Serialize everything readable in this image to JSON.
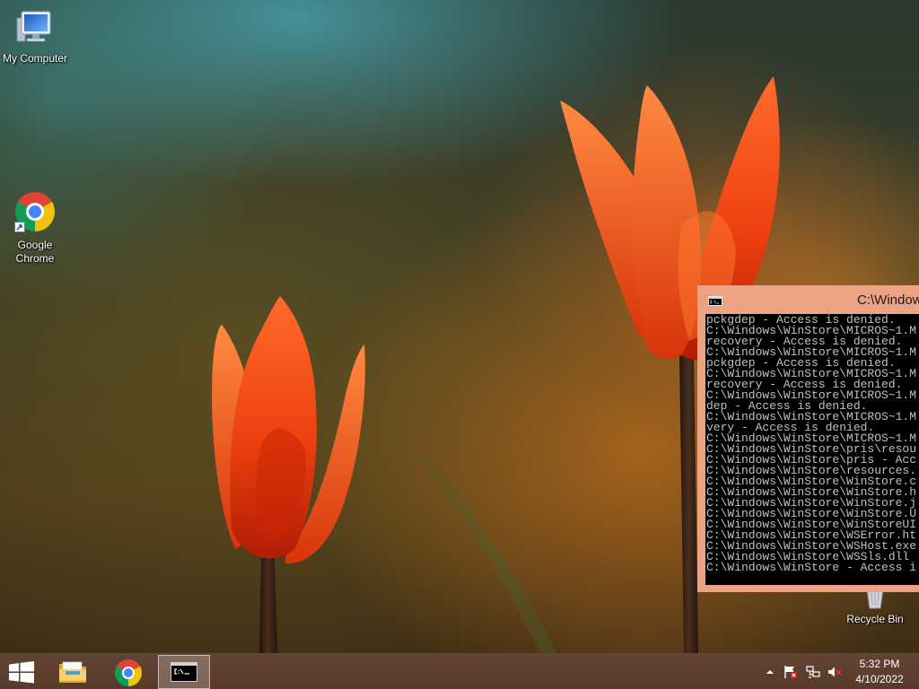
{
  "desktop": {
    "icons": {
      "my_computer": {
        "label": "My Computer",
        "icon": "my-computer-icon"
      },
      "chrome": {
        "label": "Google Chrome",
        "icon": "chrome-icon",
        "overlay": "shortcut-arrow-icon"
      },
      "recycle_bin": {
        "label": "Recycle Bin",
        "icon": "recycle-bin-icon"
      }
    }
  },
  "console_window": {
    "title": "C:\\Window",
    "icon": "cmd-icon",
    "lines": [
      "pckgdep - Access is denied.",
      "C:\\Windows\\WinStore\\MICROS~1.M",
      "recovery - Access is denied.",
      "C:\\Windows\\WinStore\\MICROS~1.M",
      "pckgdep - Access is denied.",
      "C:\\Windows\\WinStore\\MICROS~1.M",
      "recovery - Access is denied.",
      "C:\\Windows\\WinStore\\MICROS~1.M",
      "dep - Access is denied.",
      "C:\\Windows\\WinStore\\MICROS~1.M",
      "very - Access is denied.",
      "C:\\Windows\\WinStore\\MICROS~1.M",
      "C:\\Windows\\WinStore\\pris\\resou",
      "C:\\Windows\\WinStore\\pris - Acc",
      "C:\\Windows\\WinStore\\resources.",
      "C:\\Windows\\WinStore\\WinStore.c",
      "C:\\Windows\\WinStore\\WinStore.h",
      "C:\\Windows\\WinStore\\WinStore.j",
      "C:\\Windows\\WinStore\\WinStore.U",
      "C:\\Windows\\WinStore\\WinStoreUI",
      "C:\\Windows\\WinStore\\WSError.ht",
      "C:\\Windows\\WinStore\\WSHost.exe",
      "C:\\Windows\\WinStore\\WSSls.dll",
      "C:\\Windows\\WinStore - Access i"
    ]
  },
  "taskbar": {
    "start_icon": "windows-logo-icon",
    "items": [
      {
        "icon": "file-explorer-icon",
        "active": false
      },
      {
        "icon": "chrome-icon",
        "active": false
      },
      {
        "icon": "cmd-icon",
        "active": true
      }
    ],
    "tray": {
      "icons": [
        "show-hidden-icons-icon",
        "action-center-flag-icon",
        "network-icon",
        "volume-muted-icon"
      ]
    },
    "clock": {
      "time": "5:32 PM",
      "date": "4/10/2022"
    }
  },
  "colors": {
    "window_frame": "#eba384",
    "console_background": "#000000",
    "console_text": "#c0c0c0",
    "taskbar": "#5c3e2e"
  }
}
